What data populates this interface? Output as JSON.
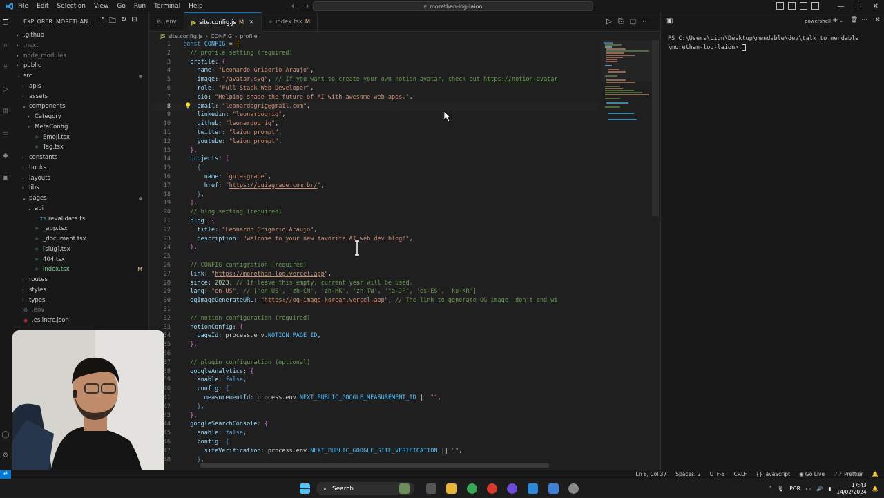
{
  "window": {
    "menu": [
      "File",
      "Edit",
      "Selection",
      "View",
      "Go",
      "Run",
      "Terminal",
      "Help"
    ],
    "search_text": "morethan-log-laion"
  },
  "explorer": {
    "title": "EXPLORER: MORETHAN...",
    "items": [
      {
        "label": ".github",
        "depth": 1,
        "type": "folder",
        "open": false
      },
      {
        "label": ".next",
        "depth": 1,
        "type": "folder",
        "open": false,
        "dim": true
      },
      {
        "label": "node_modules",
        "depth": 1,
        "type": "folder",
        "open": false,
        "dim": true
      },
      {
        "label": "public",
        "depth": 1,
        "type": "folder",
        "open": false
      },
      {
        "label": "src",
        "depth": 1,
        "type": "folder",
        "open": true,
        "dot": true
      },
      {
        "label": "apis",
        "depth": 2,
        "type": "folder",
        "open": false
      },
      {
        "label": "assets",
        "depth": 2,
        "type": "folder",
        "open": false
      },
      {
        "label": "components",
        "depth": 2,
        "type": "folder",
        "open": true
      },
      {
        "label": "Category",
        "depth": 3,
        "type": "folder",
        "open": false
      },
      {
        "label": "MetaConfig",
        "depth": 3,
        "type": "folder",
        "open": false
      },
      {
        "label": "Emoji.tsx",
        "depth": 3,
        "type": "tsx"
      },
      {
        "label": "Tag.tsx",
        "depth": 3,
        "type": "tsx"
      },
      {
        "label": "constants",
        "depth": 2,
        "type": "folder",
        "open": false
      },
      {
        "label": "hooks",
        "depth": 2,
        "type": "folder",
        "open": false
      },
      {
        "label": "layouts",
        "depth": 2,
        "type": "folder",
        "open": false
      },
      {
        "label": "libs",
        "depth": 2,
        "type": "folder",
        "open": false
      },
      {
        "label": "pages",
        "depth": 2,
        "type": "folder",
        "open": true,
        "dot": true
      },
      {
        "label": "api",
        "depth": 3,
        "type": "folder",
        "open": true
      },
      {
        "label": "revalidate.ts",
        "depth": 4,
        "type": "ts"
      },
      {
        "label": "_app.tsx",
        "depth": 3,
        "type": "tsx"
      },
      {
        "label": "_document.tsx",
        "depth": 3,
        "type": "tsx"
      },
      {
        "label": "[slug].tsx",
        "depth": 3,
        "type": "tsx"
      },
      {
        "label": "404.tsx",
        "depth": 3,
        "type": "tsx"
      },
      {
        "label": "index.tsx",
        "depth": 3,
        "type": "tsx",
        "modified": true,
        "badge": "M"
      },
      {
        "label": "routes",
        "depth": 2,
        "type": "folder",
        "open": false
      },
      {
        "label": "styles",
        "depth": 2,
        "type": "folder",
        "open": false
      },
      {
        "label": "types",
        "depth": 2,
        "type": "folder",
        "open": false
      },
      {
        "label": ".env",
        "depth": 1,
        "type": "env",
        "dim": true
      },
      {
        "label": ".eslintrc.json",
        "depth": 1,
        "type": "json"
      }
    ]
  },
  "tabs": [
    {
      "label": ".env",
      "active": false,
      "icon": "gear"
    },
    {
      "label": "site.config.js",
      "active": true,
      "modified": "M",
      "icon": "js"
    },
    {
      "label": "index.tsx",
      "active": false,
      "modified": "M",
      "icon": "react"
    }
  ],
  "breadcrumb": [
    "site.config.js",
    "CONFIG",
    "profile"
  ],
  "code_lines": [
    "1",
    "2",
    "3",
    "4",
    "5",
    "6",
    "7",
    "8",
    "9",
    "10",
    "11",
    "12",
    "13",
    "14",
    "15",
    "16",
    "17",
    "18",
    "19",
    "20",
    "21",
    "22",
    "23",
    "24",
    "25",
    "26",
    "27",
    "28",
    "29",
    "30",
    "31",
    "32",
    "33",
    "34",
    "35",
    "36",
    "37",
    "38",
    "39",
    "40",
    "41",
    "42",
    "43",
    "44",
    "45",
    "46",
    "47",
    "48"
  ],
  "current_line": 8,
  "terminal": {
    "shell_label": "powershell",
    "prompt_line1": "PS C:\\Users\\Lion\\Desktop\\mendable\\dev\\talk_to_mendable",
    "prompt_line2": "\\morethan-log-laion> "
  },
  "status": {
    "position": "Ln 8, Col 37",
    "spaces": "Spaces: 2",
    "encoding": "UTF-8",
    "eol": "CRLF",
    "language": "JavaScript",
    "golive": "Go Live",
    "prettier": "Prettier"
  },
  "taskbar": {
    "search_label": "Search",
    "lang": "POR",
    "time": "17:43",
    "date": "14/02/2024"
  }
}
